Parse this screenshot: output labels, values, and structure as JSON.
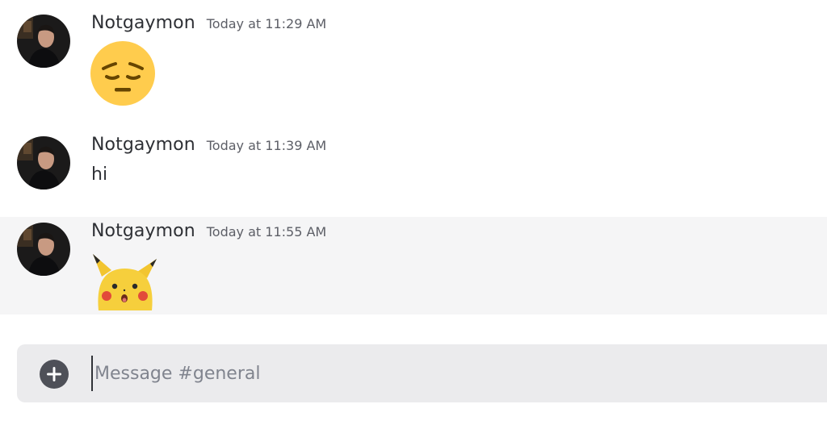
{
  "messages": [
    {
      "username": "Notgaymon",
      "timestamp": "Today at 11:29 AM",
      "content_type": "emoji",
      "emoji": "pensive-face"
    },
    {
      "username": "Notgaymon",
      "timestamp": "Today at 11:39 AM",
      "content_type": "text",
      "text": "hi"
    },
    {
      "username": "Notgaymon",
      "timestamp": "Today at 11:55 AM",
      "content_type": "sticker",
      "sticker": "surprised-pikachu",
      "hovered": true
    }
  ],
  "composer": {
    "placeholder": "Message #general",
    "value": ""
  },
  "colors": {
    "background": "#ffffff",
    "hover_row": "#f5f5f6",
    "composer_bg": "#ebebed",
    "username": "#2e3035",
    "timestamp": "#5c5e66",
    "emoji_yellow": "#ffcc4d",
    "plus_button": "#4e5058"
  }
}
